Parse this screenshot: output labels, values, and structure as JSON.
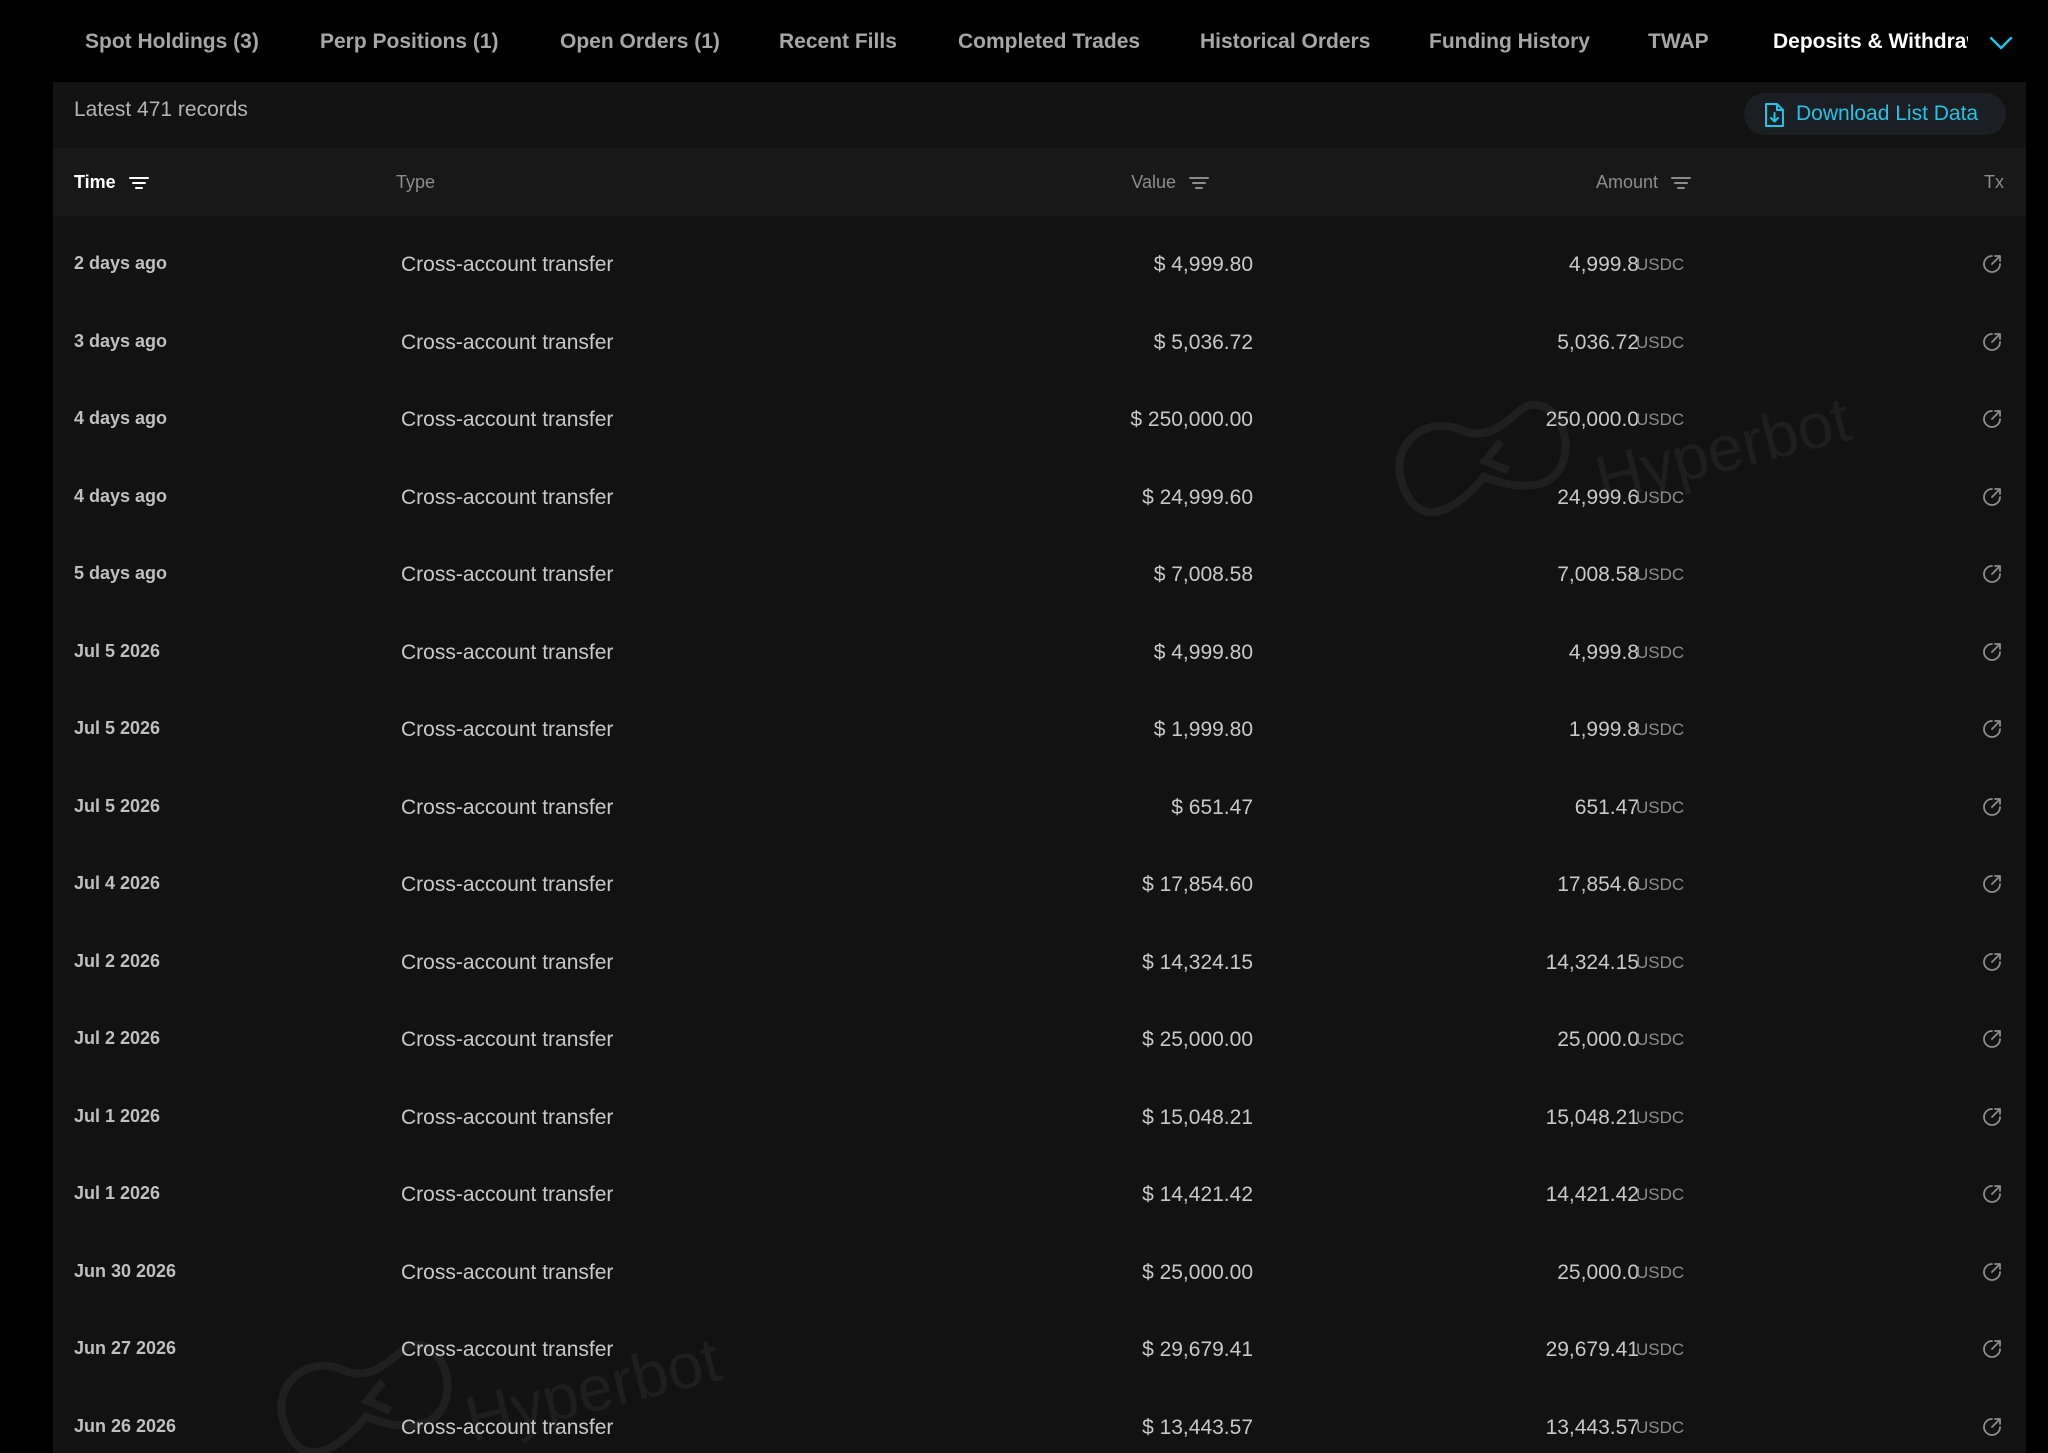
{
  "tabs": [
    {
      "label": "Spot Holdings (3)"
    },
    {
      "label": "Perp Positions (1)"
    },
    {
      "label": "Open Orders (1)"
    },
    {
      "label": "Recent Fills"
    },
    {
      "label": "Completed Trades"
    },
    {
      "label": "Historical Orders"
    },
    {
      "label": "Funding History"
    },
    {
      "label": "TWAP"
    },
    {
      "label": "Deposits & Withdrawals"
    }
  ],
  "active_tab": "Deposits & Withdrawals",
  "panel": {
    "records_label": "Latest 471 records",
    "download_label": "Download List Data"
  },
  "columns": {
    "time": "Time",
    "type": "Type",
    "value": "Value",
    "amount": "Amount",
    "tx": "Tx"
  },
  "rows": [
    {
      "time": "2 days ago",
      "type": "Cross-account transfer",
      "value": "$ 4,999.80",
      "amount": "4,999.8",
      "unit": "USDC"
    },
    {
      "time": "3 days ago",
      "type": "Cross-account transfer",
      "value": "$ 5,036.72",
      "amount": "5,036.72",
      "unit": "USDC"
    },
    {
      "time": "4 days ago",
      "type": "Cross-account transfer",
      "value": "$ 250,000.00",
      "amount": "250,000.0",
      "unit": "USDC"
    },
    {
      "time": "4 days ago",
      "type": "Cross-account transfer",
      "value": "$ 24,999.60",
      "amount": "24,999.6",
      "unit": "USDC"
    },
    {
      "time": "5 days ago",
      "type": "Cross-account transfer",
      "value": "$ 7,008.58",
      "amount": "7,008.58",
      "unit": "USDC"
    },
    {
      "time": "Jul 5 2026",
      "type": "Cross-account transfer",
      "value": "$ 4,999.80",
      "amount": "4,999.8",
      "unit": "USDC"
    },
    {
      "time": "Jul 5 2026",
      "type": "Cross-account transfer",
      "value": "$ 1,999.80",
      "amount": "1,999.8",
      "unit": "USDC"
    },
    {
      "time": "Jul 5 2026",
      "type": "Cross-account transfer",
      "value": "$ 651.47",
      "amount": "651.47",
      "unit": "USDC"
    },
    {
      "time": "Jul 4 2026",
      "type": "Cross-account transfer",
      "value": "$ 17,854.60",
      "amount": "17,854.6",
      "unit": "USDC"
    },
    {
      "time": "Jul 2 2026",
      "type": "Cross-account transfer",
      "value": "$ 14,324.15",
      "amount": "14,324.15",
      "unit": "USDC"
    },
    {
      "time": "Jul 2 2026",
      "type": "Cross-account transfer",
      "value": "$ 25,000.00",
      "amount": "25,000.0",
      "unit": "USDC"
    },
    {
      "time": "Jul 1 2026",
      "type": "Cross-account transfer",
      "value": "$ 15,048.21",
      "amount": "15,048.21",
      "unit": "USDC"
    },
    {
      "time": "Jul 1 2026",
      "type": "Cross-account transfer",
      "value": "$ 14,421.42",
      "amount": "14,421.42",
      "unit": "USDC"
    },
    {
      "time": "Jun 30 2026",
      "type": "Cross-account transfer",
      "value": "$ 25,000.00",
      "amount": "25,000.0",
      "unit": "USDC"
    },
    {
      "time": "Jun 27 2026",
      "type": "Cross-account transfer",
      "value": "$ 29,679.41",
      "amount": "29,679.41",
      "unit": "USDC"
    },
    {
      "time": "Jun 26 2026",
      "type": "Cross-account transfer",
      "value": "$ 13,443.57",
      "amount": "13,443.57",
      "unit": "USDC"
    }
  ],
  "watermark": "Hyperbot",
  "icons": {
    "tab_more": "chevron-down-icon",
    "download": "download-file-icon",
    "filter": "filter-icon",
    "tx": "external-link-icon"
  },
  "colors": {
    "accent": "#22c3e6",
    "background": "#000000",
    "panel": "#121212",
    "header": "#181818"
  }
}
